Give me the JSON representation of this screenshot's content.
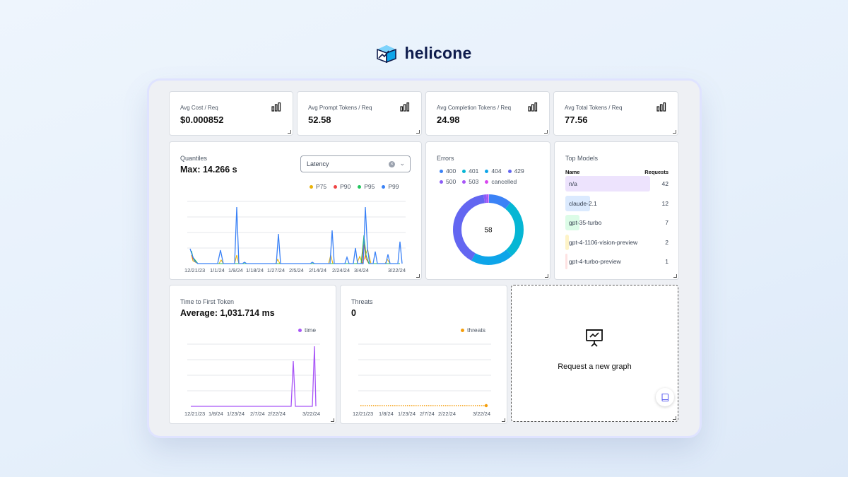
{
  "brand": {
    "name": "helicone"
  },
  "kpis": [
    {
      "label": "Avg Cost / Req",
      "value": "$0.000852"
    },
    {
      "label": "Avg Prompt Tokens / Req",
      "value": "52.58"
    },
    {
      "label": "Avg Completion Tokens / Req",
      "value": "24.98"
    },
    {
      "label": "Avg Total Tokens / Req",
      "value": "77.56"
    }
  ],
  "quantiles": {
    "title": "Quantiles",
    "max_label": "Max: 14.266 s",
    "select_value": "Latency",
    "legend": [
      "P75",
      "P90",
      "P95",
      "P99"
    ],
    "colors": {
      "P75": "#eab308",
      "P90": "#ef4444",
      "P95": "#22c55e",
      "P99": "#3b82f6"
    },
    "x_ticks": [
      "12/21/23",
      "1/1/24",
      "1/9/24",
      "1/18/24",
      "1/27/24",
      "2/5/24",
      "2/14/24",
      "2/24/24",
      "3/4/24",
      "3/22/24"
    ]
  },
  "errors": {
    "title": "Errors",
    "legend_row1": [
      {
        "label": "400",
        "color": "#3b82f6"
      },
      {
        "label": "401",
        "color": "#06b6d4"
      },
      {
        "label": "404",
        "color": "#0ea5e9"
      },
      {
        "label": "429",
        "color": "#6366f1"
      }
    ],
    "legend_row2": [
      {
        "label": "500",
        "color": "#8b5cf6"
      },
      {
        "label": "503",
        "color": "#a855f7"
      },
      {
        "label": "cancelled",
        "color": "#d946ef"
      }
    ],
    "center_value": "58"
  },
  "top_models": {
    "title": "Top Models",
    "col_name": "Name",
    "col_requests": "Requests",
    "rows": [
      {
        "name": "n/a",
        "count": "42",
        "color": "#ede3fd",
        "share": 1.0
      },
      {
        "name": "claude-2.1",
        "count": "12",
        "color": "#dbeafe",
        "share": 0.29
      },
      {
        "name": "gpt-35-turbo",
        "count": "7",
        "color": "#dcfce7",
        "share": 0.17
      },
      {
        "name": "gpt-4-1106-vision-preview",
        "count": "2",
        "color": "#fef3c7",
        "share": 0.05
      },
      {
        "name": "gpt-4-turbo-preview",
        "count": "1",
        "color": "#fee2e2",
        "share": 0.02
      }
    ]
  },
  "ttft": {
    "title": "Time to First Token",
    "avg_label": "Average: 1,031.714 ms",
    "legend": "time",
    "color": "#a855f7",
    "x_ticks": [
      "12/21/23",
      "1/8/24",
      "1/23/24",
      "2/7/24",
      "2/22/24",
      "3/22/24"
    ]
  },
  "threats": {
    "title": "Threats",
    "value": "0",
    "legend": "threats",
    "color": "#f59e0b",
    "x_ticks": [
      "12/21/23",
      "1/8/24",
      "1/23/24",
      "2/7/24",
      "2/22/24",
      "3/22/24"
    ]
  },
  "request_graph": {
    "label": "Request a new graph"
  }
}
